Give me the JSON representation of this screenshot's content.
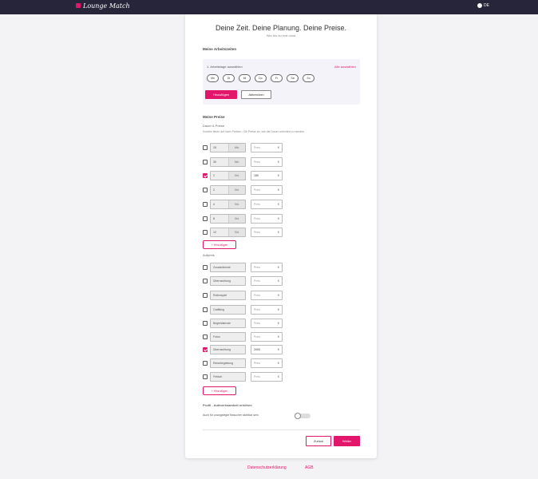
{
  "header": {
    "logo_text": "Lounge Match",
    "language": "DE"
  },
  "page": {
    "title": "Deine Zeit. Deine Planung. Deine Preise.",
    "subtitle": "Wer bis du erst crust"
  },
  "days": {
    "heading": "Meine Arbeitszeiten",
    "label": "1. Arbeitstage auswählen",
    "select_all": "Alle auswählen",
    "chips": [
      "Mo",
      "Di",
      "Mi",
      "Do",
      "Fr",
      "Sa",
      "So"
    ],
    "confirm_button": "Hinzufügen",
    "clear_button": "Abbrechen"
  },
  "prices": {
    "heading": "Meine Preise",
    "sub": "Dauer & Preise",
    "hint": "Kombin ifinen auf nach Preisen, Gib Preise an, wie die Dauer anfordert zu werden",
    "durations": [
      {
        "num": "15",
        "unit": "Min.",
        "price": "Preis",
        "checked": false
      },
      {
        "num": "30",
        "unit": "Min.",
        "price": "Preis",
        "checked": false
      },
      {
        "num": "1",
        "unit": "Std.",
        "price": "180",
        "checked": true
      },
      {
        "num": "2",
        "unit": "Std.",
        "price": "Preis",
        "checked": false
      },
      {
        "num": "4",
        "unit": "Std.",
        "price": "Preis",
        "checked": false
      },
      {
        "num": "8",
        "unit": "Std.",
        "price": "Preis",
        "checked": false
      },
      {
        "num": "12",
        "unit": "Std.",
        "price": "Preis",
        "checked": false
      }
    ],
    "add_duration_button": "+ Hinzufügen",
    "currency": "€"
  },
  "extras": {
    "heading": "Aufpreis",
    "items": [
      {
        "label": "Zusatzdienste",
        "price": "Preis",
        "checked": false
      },
      {
        "label": "Übernachtung",
        "price": "Preis",
        "checked": false
      },
      {
        "label": "Rollenspiel",
        "price": "Preis",
        "checked": false
      },
      {
        "label": "Outfitting",
        "price": "Preis",
        "checked": false
      },
      {
        "label": "Begleitdienste",
        "price": "Preis",
        "checked": false
      },
      {
        "label": "Fotos",
        "price": "Preis",
        "checked": false
      },
      {
        "label": "Übernachtung",
        "price": "2000",
        "checked": true
      },
      {
        "label": "Reisebegleitung",
        "price": "Preis",
        "checked": false
      },
      {
        "label": "Fetisch",
        "price": "Preis",
        "checked": false
      }
    ],
    "add_extra_button": "+ Hinzufügen"
  },
  "profile": {
    "heading": "Profil - Aufmerksamkeit erhöhen",
    "toggle_label": "Auch für unangelegte Besucher sichtbar sein"
  },
  "actions": {
    "back": "Zurück",
    "next": "Weiter"
  },
  "footer": {
    "privacy": "Datenschutzerklärung",
    "terms": "AGB"
  }
}
